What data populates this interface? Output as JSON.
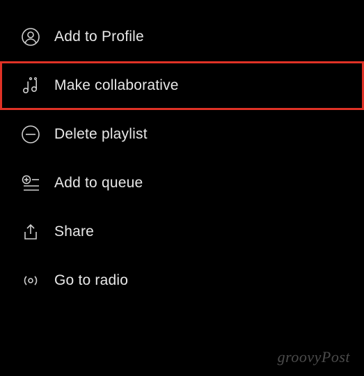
{
  "menu": {
    "items": [
      {
        "label": "Add to Profile"
      },
      {
        "label": "Make collaborative"
      },
      {
        "label": "Delete playlist"
      },
      {
        "label": "Add to queue"
      },
      {
        "label": "Share"
      },
      {
        "label": "Go to radio"
      }
    ]
  },
  "watermark": "groovyPost"
}
